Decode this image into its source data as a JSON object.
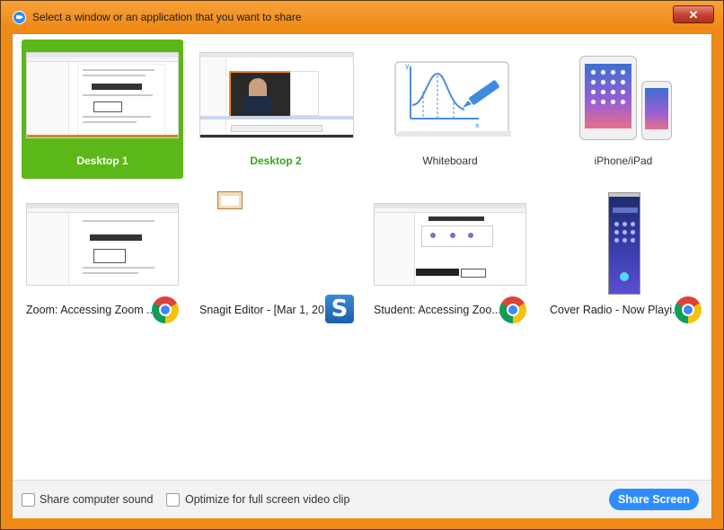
{
  "window": {
    "title": "Select a window or an application that you want to share",
    "close_label": "✕"
  },
  "screens": [
    {
      "label": "Desktop 1",
      "selected": true
    },
    {
      "label": "Desktop 2"
    },
    {
      "label": "Whiteboard"
    },
    {
      "label": "iPhone/iPad"
    }
  ],
  "windows": [
    {
      "label": "Zoom: Accessing Zoom ...",
      "icon": "chrome-icon"
    },
    {
      "label": "Snagit Editor - [Mar 1, 20...",
      "icon": "snagit-icon",
      "icon_letter": "S"
    },
    {
      "label": "Student: Accessing Zoo...",
      "icon": "chrome-icon"
    },
    {
      "label": "Cover Radio - Now Playi...",
      "icon": "chrome-icon"
    }
  ],
  "footer": {
    "share_sound_label": "Share computer sound",
    "optimize_label": "Optimize for full screen video clip",
    "share_button": "Share Screen"
  },
  "colors": {
    "accent": "#2d8cff",
    "selected": "#5bb818",
    "titlebar": "#ef8a16"
  }
}
